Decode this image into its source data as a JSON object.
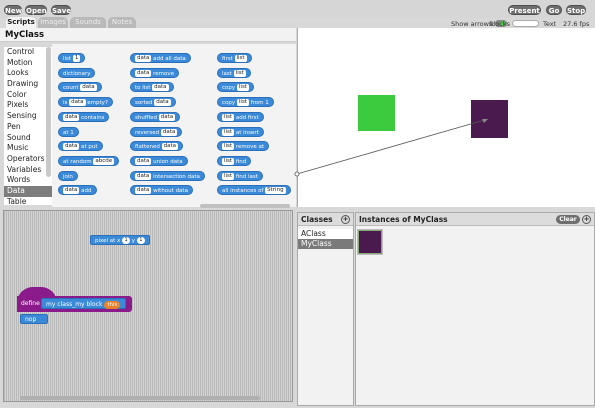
{
  "toolbar": {
    "new_label": "New",
    "open_label": "Open",
    "save_label": "Save",
    "present_label": "Present",
    "go_label": "Go",
    "stop_label": "Stop",
    "show_arrows_label": "Show arrows:",
    "blocks_label": "Blocks",
    "text_label": "Text",
    "fps_label": "27.6 fps"
  },
  "tabs": [
    {
      "label": "Scripts",
      "active": true
    },
    {
      "label": "Images",
      "active": false
    },
    {
      "label": "Sounds",
      "active": false
    },
    {
      "label": "Notes",
      "active": false
    }
  ],
  "class_title": "MyClass",
  "categories": [
    {
      "label": "Control"
    },
    {
      "label": "Motion"
    },
    {
      "label": "Looks"
    },
    {
      "label": "Drawing"
    },
    {
      "label": "Color"
    },
    {
      "label": "Pixels"
    },
    {
      "label": "Sensing"
    },
    {
      "label": "Pen"
    },
    {
      "label": "Sound"
    },
    {
      "label": "Music"
    },
    {
      "label": "Operators"
    },
    {
      "label": "Variables"
    },
    {
      "label": "Words"
    },
    {
      "label": "Data"
    },
    {
      "label": "Table"
    }
  ],
  "selected_category": "Data",
  "palette": {
    "col1": [
      {
        "pre": "list",
        "s1": "1",
        "post": ""
      },
      {
        "pre": "dictionary",
        "s1": "",
        "post": ""
      },
      {
        "pre": "count",
        "s1": "data",
        "post": ""
      },
      {
        "pre": "is",
        "s1": "data",
        "post": "empty?"
      },
      {
        "pre": "",
        "s1": "data",
        "post": "contains"
      },
      {
        "pre": "",
        "s1": "",
        "post": "at 1"
      },
      {
        "pre": "",
        "s1": "data",
        "post": "at  put"
      },
      {
        "pre": "at random",
        "s1": "abcde",
        "post": ""
      },
      {
        "pre": "join",
        "s1": "",
        "post": ""
      },
      {
        "pre": "",
        "s1": "data",
        "post": "add"
      }
    ],
    "col2": [
      {
        "pre": "",
        "s1": "data",
        "post": "add all data"
      },
      {
        "pre": "",
        "s1": "data",
        "post": "remove"
      },
      {
        "pre": "to list",
        "s1": "data",
        "post": ""
      },
      {
        "pre": "sorted",
        "s1": "data",
        "post": ""
      },
      {
        "pre": "shuffled",
        "s1": "data",
        "post": ""
      },
      {
        "pre": "reversed",
        "s1": "data",
        "post": ""
      },
      {
        "pre": "flattened",
        "s1": "data",
        "post": ""
      },
      {
        "pre": "",
        "s1": "data",
        "post": "union data"
      },
      {
        "pre": "",
        "s1": "data",
        "post": "intersection data"
      },
      {
        "pre": "",
        "s1": "data",
        "post": "without data"
      }
    ],
    "col3": [
      {
        "pre": "first",
        "s1": "list",
        "post": ""
      },
      {
        "pre": "last",
        "s1": "list",
        "post": ""
      },
      {
        "pre": "copy",
        "s1": "list",
        "post": ""
      },
      {
        "pre": "copy",
        "s1": "list",
        "post": "from 1"
      },
      {
        "pre": "",
        "s1": "list",
        "post": "add  first"
      },
      {
        "pre": "",
        "s1": "list",
        "post": "at  insert"
      },
      {
        "pre": "",
        "s1": "list",
        "post": "remove at"
      },
      {
        "pre": "",
        "s1": "list",
        "post": "find"
      },
      {
        "pre": "",
        "s1": "list",
        "post": "find last"
      },
      {
        "pre": "all instances of",
        "s1": "String",
        "post": ""
      }
    ]
  },
  "script": {
    "pixel_block": {
      "pre": "pixel at x",
      "x": "1",
      "mid": "y",
      "y": "1"
    },
    "define_label": "define",
    "custom_block_label": "my class_my block",
    "this_label": "this",
    "nop_label": "nop"
  },
  "classes_panel": {
    "title": "Classes",
    "items": [
      {
        "label": "AClass",
        "selected": false
      },
      {
        "label": "MyClass",
        "selected": true
      }
    ]
  },
  "instances_panel": {
    "title": "Instances of MyClass",
    "clear_label": "Clear"
  },
  "colors": {
    "sprite_green": "#3ccb3f",
    "sprite_purple": "#4a1a4f",
    "block_blue": "#3b8ad9",
    "define_purple": "#8b1a8a"
  }
}
